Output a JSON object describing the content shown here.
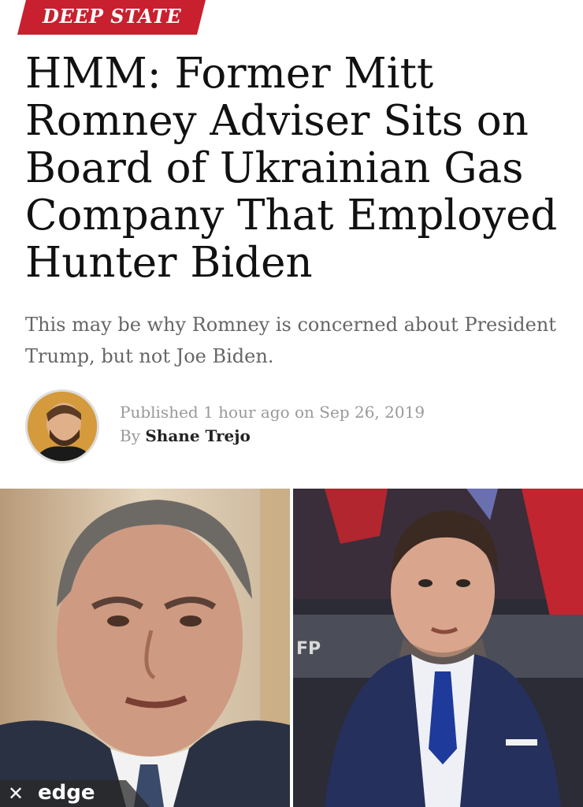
{
  "article": {
    "category": "DEEP STATE",
    "headline": "HMM: Former Mitt Romney Adviser Sits on Board of Ukrainian Gas Company That Employed Hunter Biden",
    "subtitle": "This may be why Romney is concerned about President Trump, but not Joe Biden.",
    "published": "Published 1 hour ago on Sep 26, 2019",
    "by_prefix": "By",
    "author": "Shane Trejo"
  },
  "browser": {
    "close_icon": "close-icon",
    "logo": "edge"
  },
  "colors": {
    "accent": "#c8202f",
    "headline": "#111111",
    "subtitle": "#666666",
    "meta": "#999999"
  }
}
